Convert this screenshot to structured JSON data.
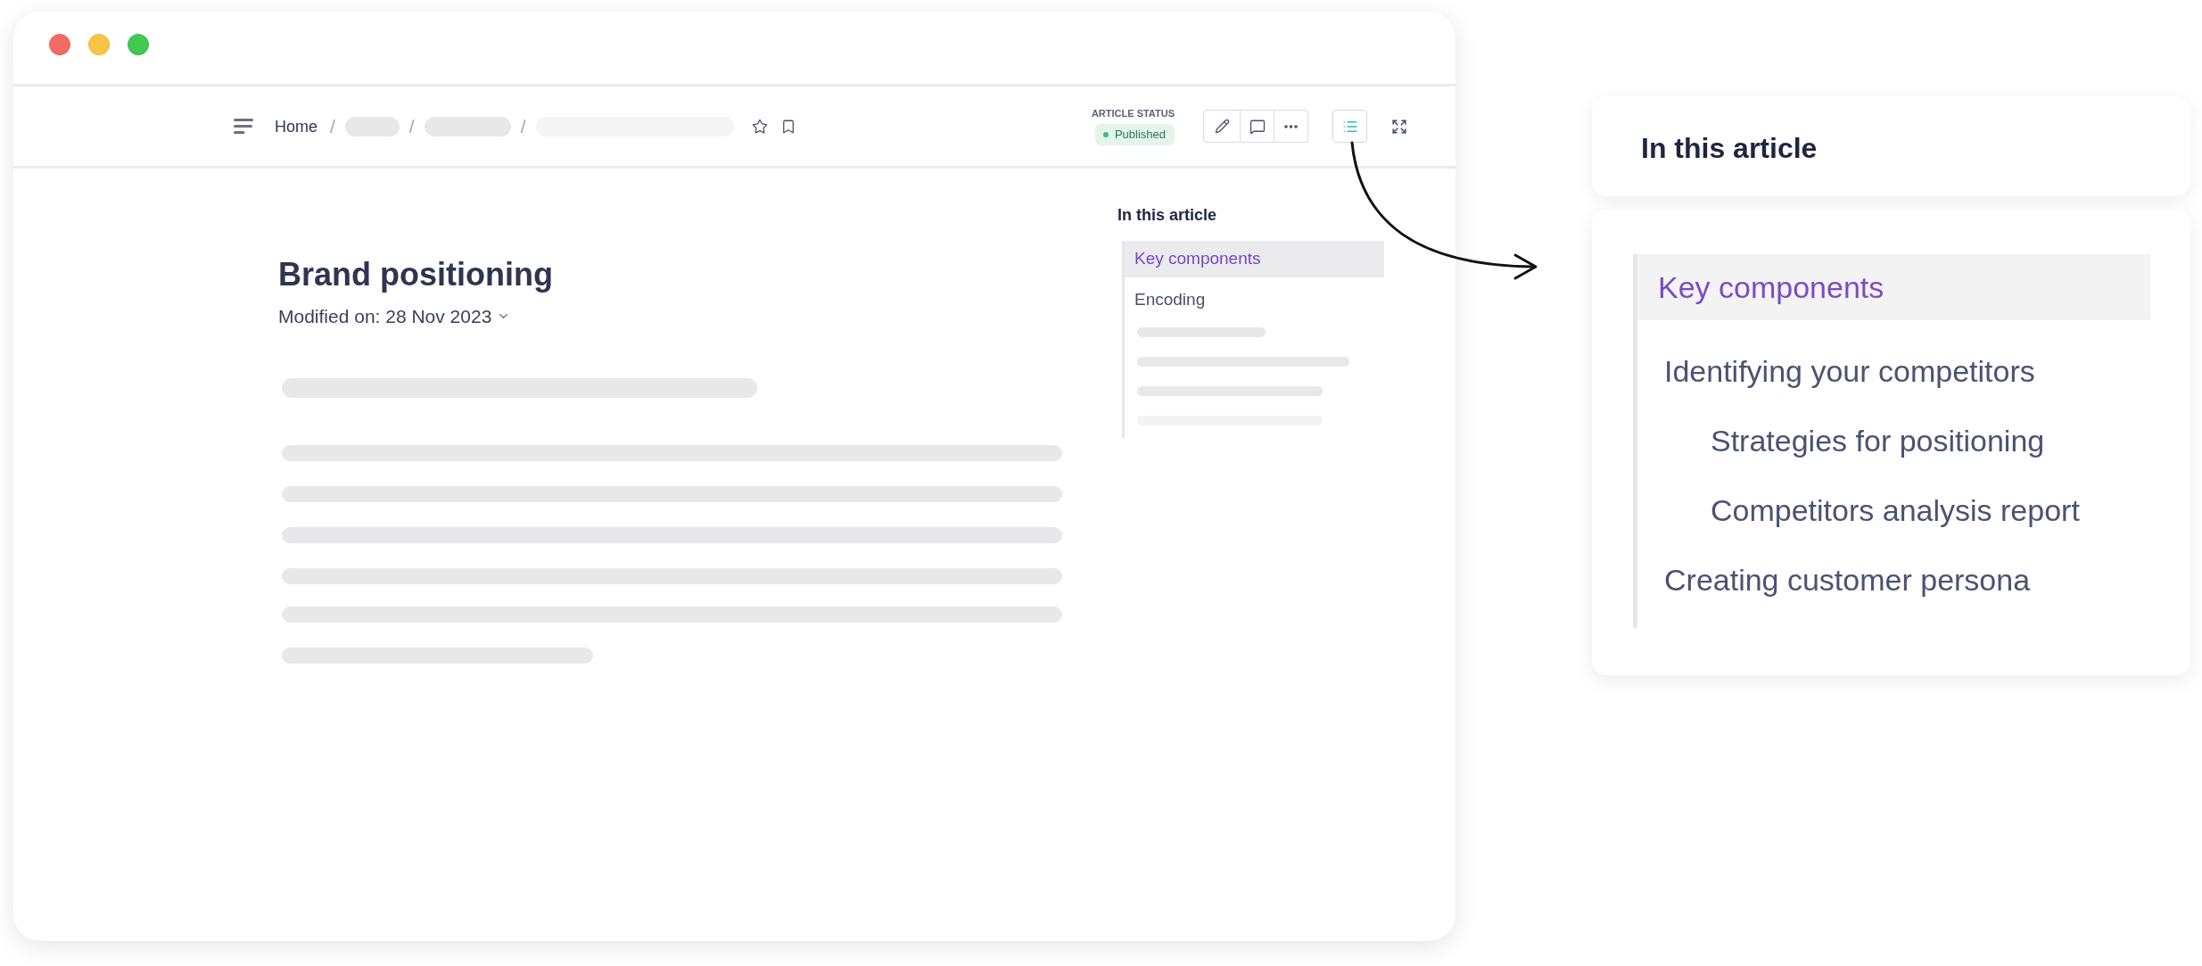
{
  "toolbar": {
    "breadcrumb": [
      {
        "kind": "link",
        "label": "Home"
      },
      {
        "kind": "separator",
        "label": "/"
      },
      {
        "kind": "skeleton"
      },
      {
        "kind": "separator",
        "label": "/"
      },
      {
        "kind": "skeleton"
      },
      {
        "kind": "separator",
        "label": "/"
      },
      {
        "kind": "skeleton"
      }
    ],
    "article_status": {
      "label": "ARTICLE STATUS",
      "badge": "Published"
    },
    "toc_toggle": {
      "on": true
    }
  },
  "article": {
    "title": "Brand positioning",
    "modified": "Modified on: 28 Nov 2023"
  },
  "toc_sidebar": {
    "title": "In this article",
    "items": [
      {
        "label": "Key components",
        "selected": true
      },
      {
        "label": "Encoding",
        "selected": false
      }
    ]
  },
  "toc_panel": {
    "title": "In this article",
    "items": [
      {
        "label": "Key components",
        "selected": true
      },
      {
        "label": "Identifying your competitors",
        "selected": false,
        "children": [
          {
            "label": "Strategies for positioning",
            "selected": false
          },
          {
            "label": "Competitors analysis report",
            "selected": false
          }
        ]
      },
      {
        "label": "Creating customer persona",
        "selected": false
      }
    ]
  }
}
